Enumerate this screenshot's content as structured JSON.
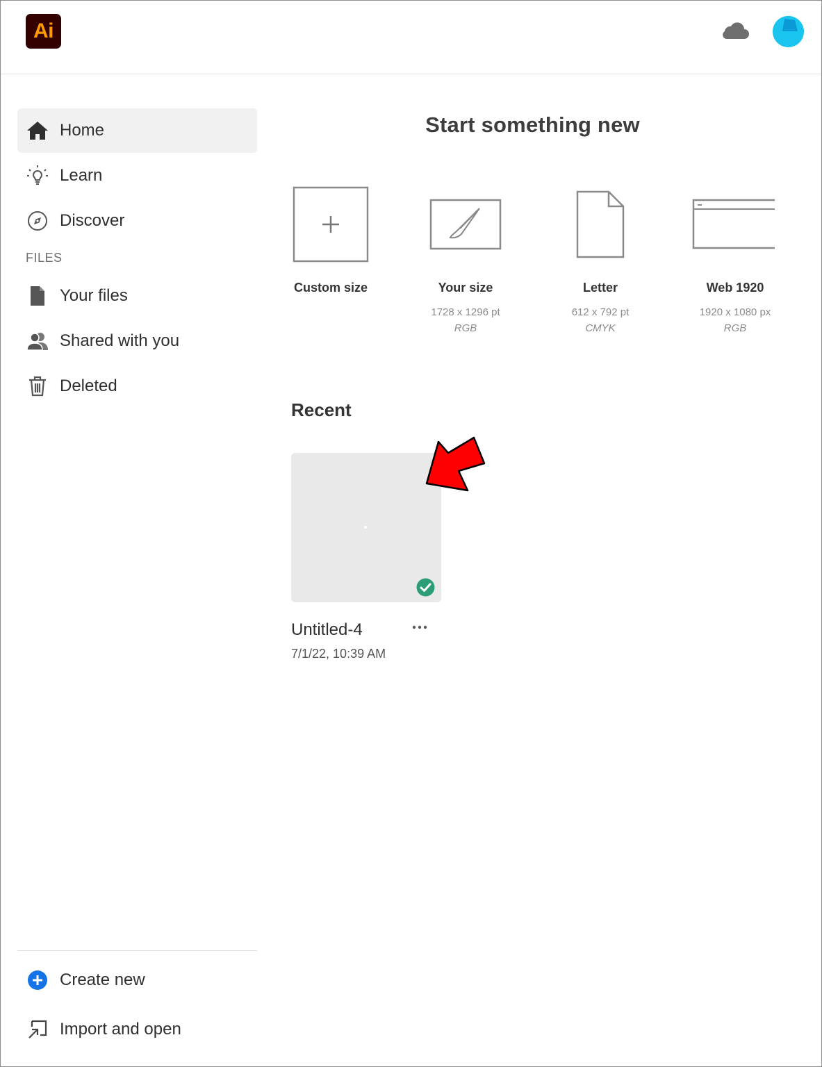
{
  "header": {
    "app_logo_text": "Ai",
    "cloud_icon": "cloud-icon",
    "avatar": "avatar"
  },
  "sidebar": {
    "items": [
      {
        "label": "Home",
        "icon": "home-icon",
        "selected": true
      },
      {
        "label": "Learn",
        "icon": "lightbulb-icon",
        "selected": false
      },
      {
        "label": "Discover",
        "icon": "compass-icon",
        "selected": false
      }
    ],
    "files_section_label": "FILES",
    "file_items": [
      {
        "label": "Your files",
        "icon": "document-icon"
      },
      {
        "label": "Shared with you",
        "icon": "users-icon"
      },
      {
        "label": "Deleted",
        "icon": "trash-icon"
      }
    ],
    "bottom_items": [
      {
        "label": "Create new",
        "icon": "add-circle-icon"
      },
      {
        "label": "Import and open",
        "icon": "import-icon"
      }
    ]
  },
  "main": {
    "title": "Start something new",
    "presets": [
      {
        "name": "Custom size",
        "dimensions": "",
        "mode": ""
      },
      {
        "name": "Your size",
        "dimensions": "1728 x 1296 pt",
        "mode": "RGB"
      },
      {
        "name": "Letter",
        "dimensions": "612 x 792 pt",
        "mode": "CMYK"
      },
      {
        "name": "Web 1920",
        "dimensions": "1920 x 1080 px",
        "mode": "RGB"
      }
    ],
    "recent_title": "Recent",
    "recent_files": [
      {
        "name": "Untitled-4",
        "date": "7/1/22, 10:39 AM",
        "synced": true
      }
    ]
  },
  "colors": {
    "accent_blue": "#1473e6",
    "logo_bg": "#330000",
    "logo_text": "#ff9a00",
    "sync_green": "#2d9d78",
    "annotation_arrow": "#ff0000",
    "avatar": "#19c5ef"
  }
}
